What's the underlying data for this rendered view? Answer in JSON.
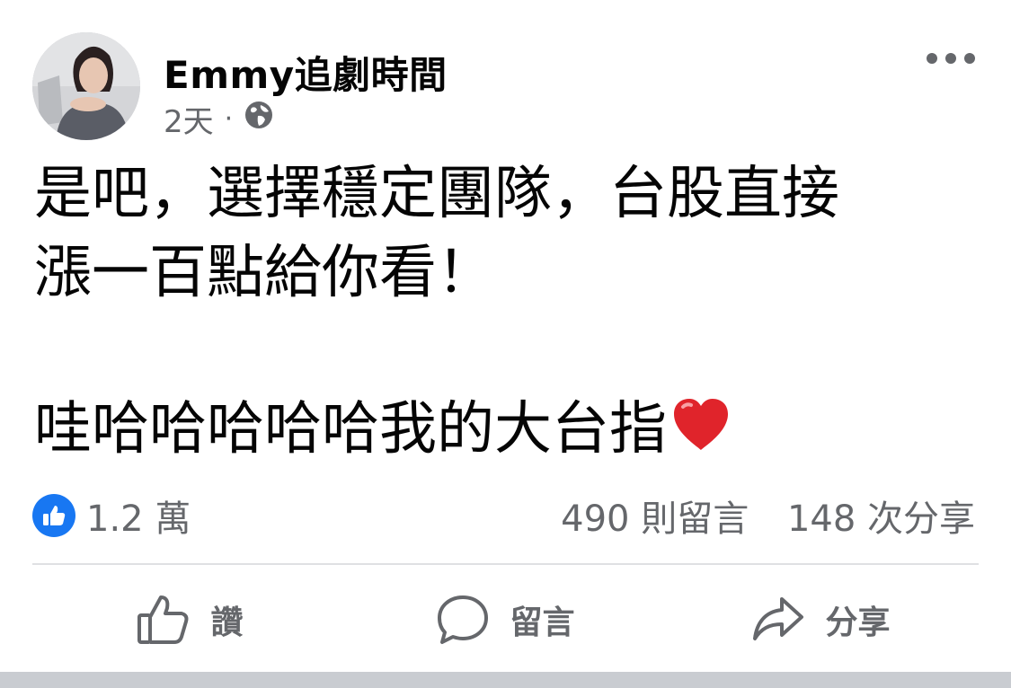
{
  "post": {
    "author": "Emmy追劇時間",
    "time": "2天",
    "separator": "·",
    "audience_icon": "globe-icon",
    "more_icon": "more-options-icon",
    "text_line1": "是吧，選擇穩定團隊，台股直接",
    "text_line2": "漲一百點給你看！",
    "text_line3": "哇哈哈哈哈哈我的大台指",
    "emoji_icon": "red-heart-icon"
  },
  "stats": {
    "reaction_icon": "like-reaction-icon",
    "reactions": "1.2 萬",
    "comments": "490 則留言",
    "shares": "148 次分享"
  },
  "actions": {
    "like_label": "讚",
    "comment_label": "留言",
    "share_label": "分享"
  },
  "colors": {
    "accent": "#1877f2",
    "secondary_text": "#65676b",
    "heart": "#e0242b",
    "divider": "#dfe0e3"
  }
}
